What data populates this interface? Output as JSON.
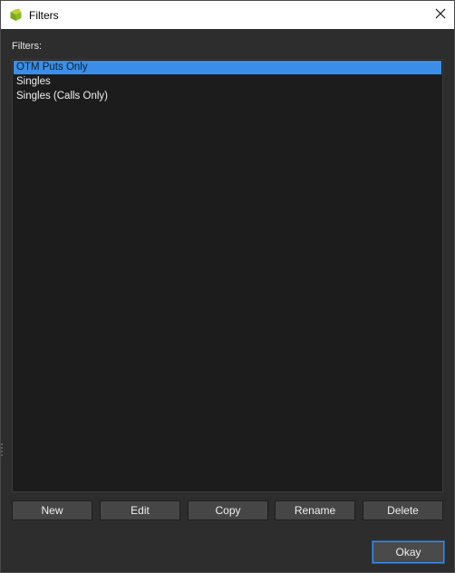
{
  "window": {
    "title": "Filters",
    "app_icon": "cube-icon",
    "close_icon": "close-icon"
  },
  "filters_label": "Filters:",
  "filters": [
    {
      "label": "OTM Puts Only",
      "selected": true
    },
    {
      "label": "Singles",
      "selected": false
    },
    {
      "label": "Singles (Calls Only)",
      "selected": false
    }
  ],
  "buttons": {
    "new": "New",
    "edit": "Edit",
    "copy": "Copy",
    "rename": "Rename",
    "delete": "Delete",
    "okay": "Okay"
  },
  "colors": {
    "background": "#2d2d2d",
    "list_background": "#1c1c1c",
    "selection": "#3b8ee8",
    "button": "#464646",
    "default_button_border": "#3b8ee8"
  }
}
